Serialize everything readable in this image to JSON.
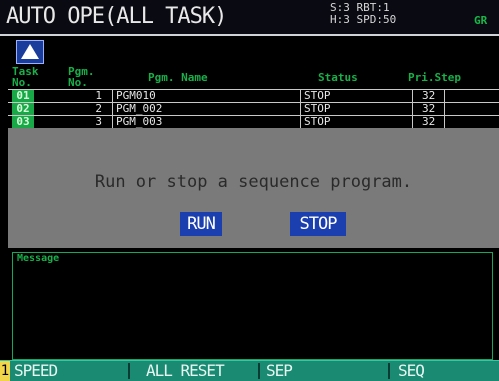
{
  "titlebar": {
    "title": "AUTO OPE(ALL TASK)",
    "status_lines": [
      "S:3  RBT:1",
      "H:3  SPD:50"
    ],
    "gr_flag": "GR"
  },
  "toolbar": {
    "up_icon": "up-triangle-icon"
  },
  "table": {
    "headers": {
      "task_no": [
        "Task",
        "No."
      ],
      "pgm_no": [
        "Pgm.",
        "No."
      ],
      "pgm_name": "Pgm. Name",
      "status": "Status",
      "pri_step": "Pri.Step"
    },
    "rows": [
      {
        "task_no": "01",
        "pgm_no": "1",
        "pgm_name": "PGM010",
        "status": "STOP",
        "pri": "32",
        "step": ""
      },
      {
        "task_no": "02",
        "pgm_no": "2",
        "pgm_name": "PGM_002",
        "status": "STOP",
        "pri": "32",
        "step": ""
      },
      {
        "task_no": "03",
        "pgm_no": "3",
        "pgm_name": "PGM_003",
        "status": "STOP",
        "pri": "32",
        "step": ""
      }
    ]
  },
  "dialog": {
    "prompt": "Run or stop a sequence program.",
    "run_label": "RUN",
    "stop_label": "STOP"
  },
  "message": {
    "label": "Message",
    "text": ""
  },
  "function_keys": [
    {
      "num": "1",
      "label": "SPEED"
    },
    {
      "num": "",
      "label": "ALL RESET"
    },
    {
      "num": "",
      "label": "SEP"
    },
    {
      "num": "",
      "label": "SEQ"
    }
  ],
  "colors": {
    "accent_green": "#19b04a",
    "button_blue": "#1c3fb0",
    "fkey_bar": "#1a8a72",
    "dialog_gray": "#7a7a7a"
  }
}
